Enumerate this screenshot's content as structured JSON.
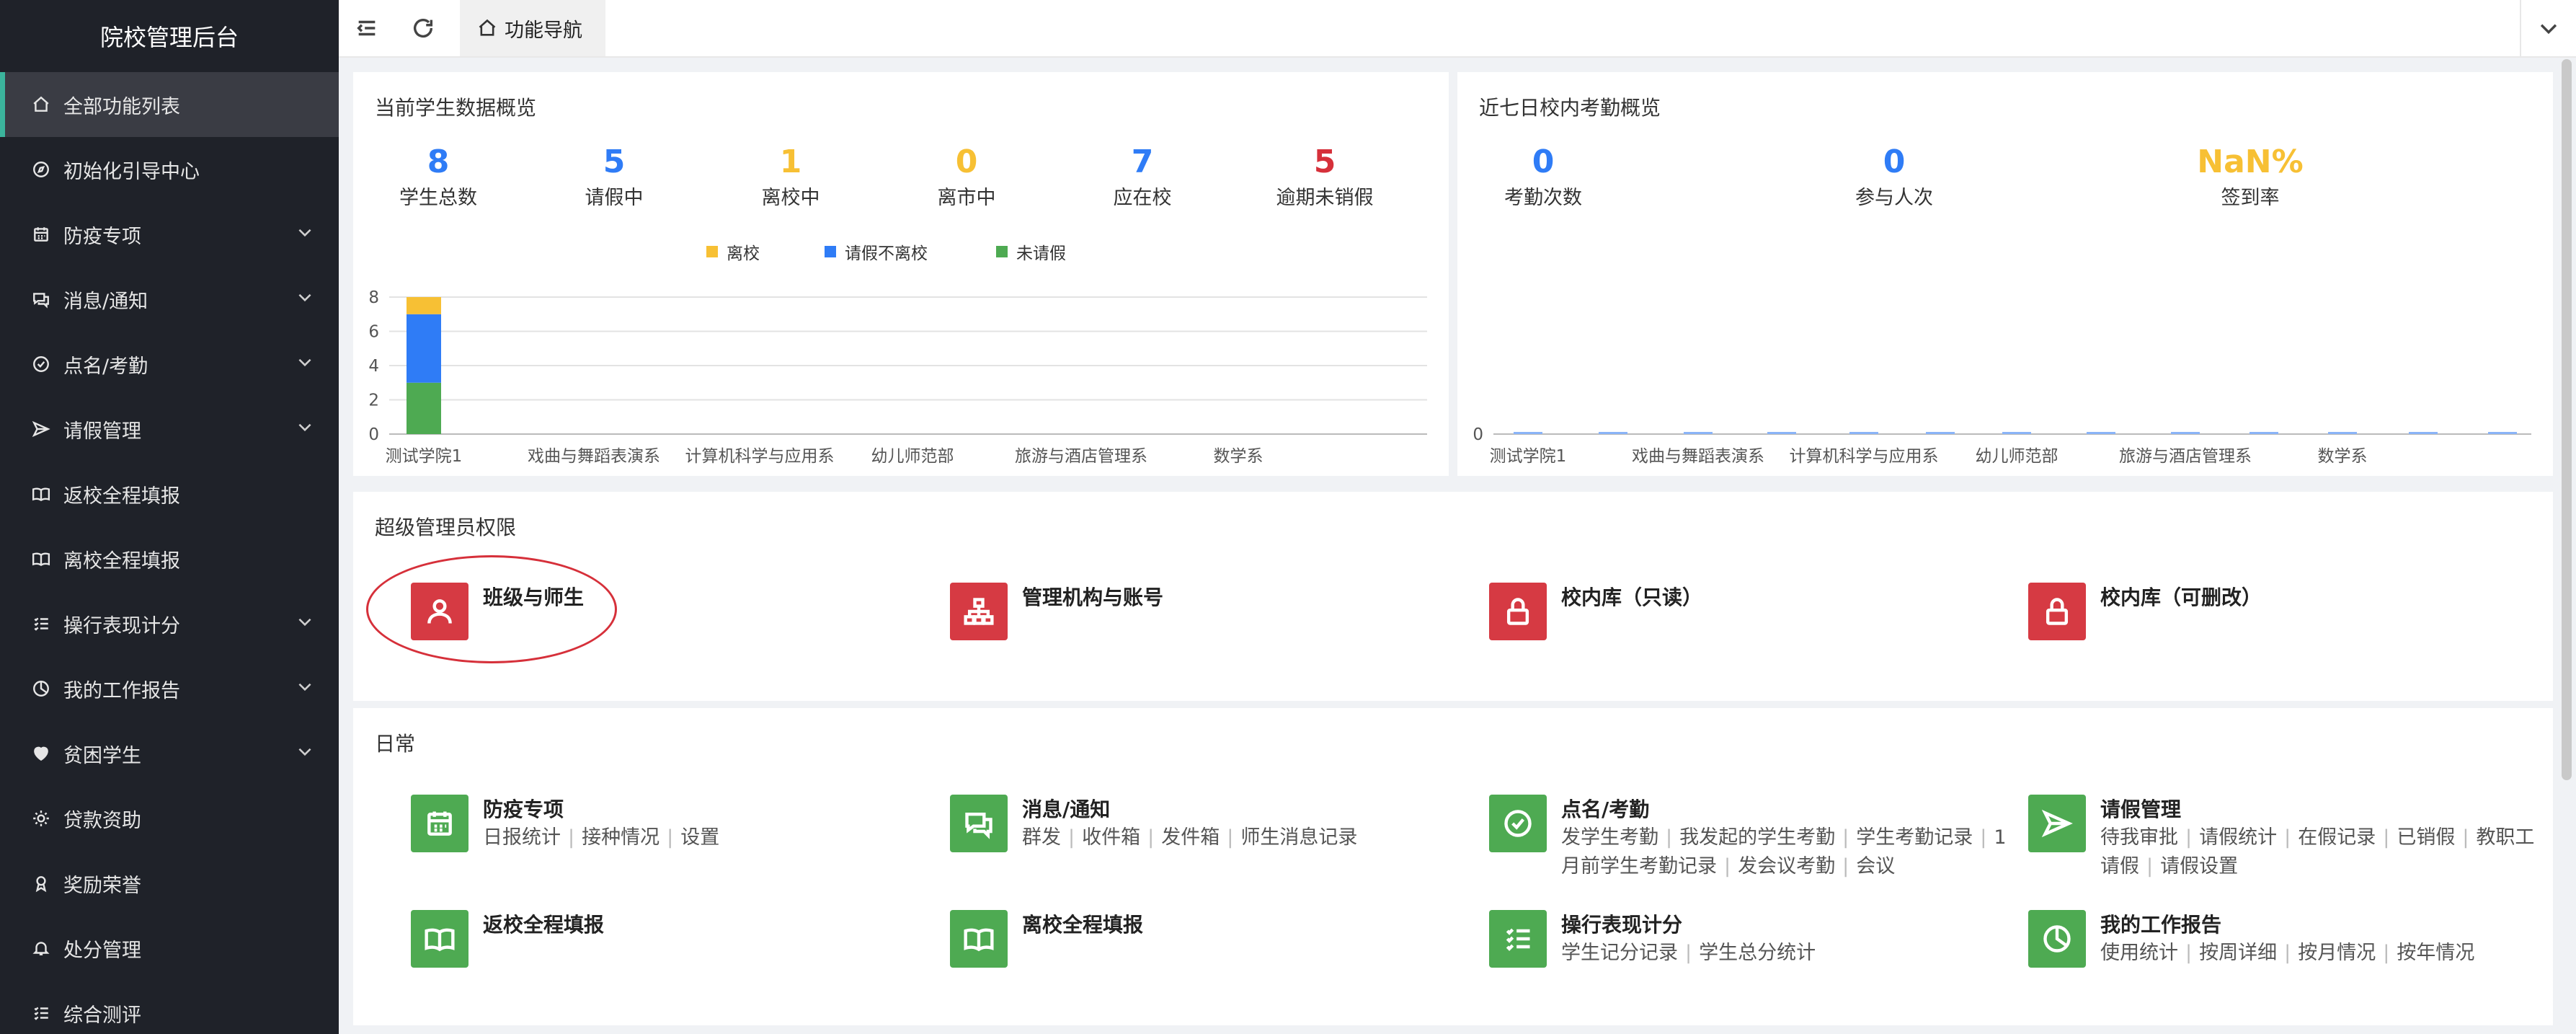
{
  "brand": {
    "title": "院校管理后台"
  },
  "sidebar": {
    "items": [
      {
        "label": "全部功能列表",
        "icon": "home-icon",
        "active": true,
        "expandable": false
      },
      {
        "label": "初始化引导中心",
        "icon": "compass-icon",
        "active": false,
        "expandable": false
      },
      {
        "label": "防疫专项",
        "icon": "calendar-icon",
        "active": false,
        "expandable": true
      },
      {
        "label": "消息/通知",
        "icon": "chat-icon",
        "active": false,
        "expandable": true
      },
      {
        "label": "点名/考勤",
        "icon": "check-circle-icon",
        "active": false,
        "expandable": true
      },
      {
        "label": "请假管理",
        "icon": "send-icon",
        "active": false,
        "expandable": true
      },
      {
        "label": "返校全程填报",
        "icon": "book-icon",
        "active": false,
        "expandable": false
      },
      {
        "label": "离校全程填报",
        "icon": "book-icon",
        "active": false,
        "expandable": false
      },
      {
        "label": "操行表现计分",
        "icon": "list-icon",
        "active": false,
        "expandable": true
      },
      {
        "label": "我的工作报告",
        "icon": "pie-icon",
        "active": false,
        "expandable": true
      },
      {
        "label": "贫困学生",
        "icon": "heart-icon",
        "active": false,
        "expandable": true
      },
      {
        "label": "贷款资助",
        "icon": "sun-icon",
        "active": false,
        "expandable": false
      },
      {
        "label": "奖励荣誉",
        "icon": "award-icon",
        "active": false,
        "expandable": false
      },
      {
        "label": "处分管理",
        "icon": "bell-icon",
        "active": false,
        "expandable": false
      },
      {
        "label": "综合测评",
        "icon": "list-icon",
        "active": false,
        "expandable": false
      }
    ]
  },
  "topbar": {
    "tab_label": "功能导航"
  },
  "student_overview": {
    "title": "当前学生数据概览",
    "stats": [
      {
        "value": "8",
        "label": "学生总数",
        "color": "#2f7cf6"
      },
      {
        "value": "5",
        "label": "请假中",
        "color": "#2f7cf6"
      },
      {
        "value": "1",
        "label": "离校中",
        "color": "#f7c034"
      },
      {
        "value": "0",
        "label": "离市中",
        "color": "#f7c034"
      },
      {
        "value": "7",
        "label": "应在校",
        "color": "#2f7cf6"
      },
      {
        "value": "5",
        "label": "逾期未销假",
        "color": "#d6303a"
      }
    ]
  },
  "attendance_overview": {
    "title": "近七日校内考勤概览",
    "stats": [
      {
        "value": "0",
        "label": "考勤次数",
        "color": "#2f7cf6"
      },
      {
        "value": "0",
        "label": "参与人次",
        "color": "#2f7cf6"
      },
      {
        "value": "NaN%",
        "label": "签到率",
        "color": "#f7c034"
      }
    ]
  },
  "chart_data": [
    {
      "type": "bar",
      "stacked": true,
      "categories": [
        "测试学院1",
        "戏曲与舞蹈表演系",
        "计算机科学与应用系",
        "幼儿师范部",
        "旅游与酒店管理系",
        "数学系"
      ],
      "series": [
        {
          "name": "离校",
          "color": "#f7c034",
          "values": [
            1,
            0,
            0,
            0,
            0,
            0
          ]
        },
        {
          "name": "请假不离校",
          "color": "#2f7cf6",
          "values": [
            4,
            0,
            0,
            0,
            0,
            0
          ]
        },
        {
          "name": "未请假",
          "color": "#4eaa52",
          "values": [
            3,
            0,
            0,
            0,
            0,
            0
          ]
        }
      ],
      "y_ticks": [
        "0",
        "2",
        "4",
        "6",
        "8"
      ],
      "ylim": [
        0,
        8
      ],
      "grid": true,
      "legend": "top"
    },
    {
      "type": "bar",
      "categories": [
        "测试学院1",
        "戏曲与舞蹈表演系",
        "计算机科学与应用系",
        "幼儿师范部",
        "旅游与酒店管理系",
        "数学系"
      ],
      "series": [
        {
          "color": "#8ab4f8",
          "values": [
            0,
            0,
            0,
            0,
            0,
            0
          ]
        }
      ],
      "y_ticks": [
        "0"
      ],
      "grid": false
    }
  ],
  "admin": {
    "title": "超级管理员权限",
    "cards": [
      {
        "title": "班级与师生",
        "icon": "user-icon"
      },
      {
        "title": "管理机构与账号",
        "icon": "org-chart-icon"
      },
      {
        "title": "校内库（只读）",
        "icon": "lock-icon"
      },
      {
        "title": "校内库（可删改）",
        "icon": "lock-icon"
      }
    ]
  },
  "daily": {
    "title": "日常",
    "cards": [
      {
        "title": "防疫专项",
        "icon": "calendar-icon",
        "links": [
          "日报统计",
          "接种情况",
          "设置"
        ]
      },
      {
        "title": "消息/通知",
        "icon": "chat-icon",
        "links": [
          "群发",
          "收件箱",
          "发件箱",
          "师生消息记录"
        ]
      },
      {
        "title": "点名/考勤",
        "icon": "check-circle-icon",
        "links": [
          "发学生考勤",
          "我发起的学生考勤",
          "学生考勤记录",
          "1月前学生考勤记录",
          "发会议考勤",
          "会议"
        ]
      },
      {
        "title": "请假管理",
        "icon": "send-icon",
        "links": [
          "待我审批",
          "请假统计",
          "在假记录",
          "已销假",
          "教职工请假",
          "请假设置"
        ]
      },
      {
        "title": "返校全程填报",
        "icon": "book-icon",
        "links": []
      },
      {
        "title": "离校全程填报",
        "icon": "book-icon",
        "links": []
      },
      {
        "title": "操行表现计分",
        "icon": "list-icon",
        "links": [
          "学生记分记录",
          "学生总分统计"
        ]
      },
      {
        "title": "我的工作报告",
        "icon": "pie-icon",
        "links": [
          "使用统计",
          "按周详细",
          "按月情况",
          "按年情况"
        ]
      }
    ]
  }
}
